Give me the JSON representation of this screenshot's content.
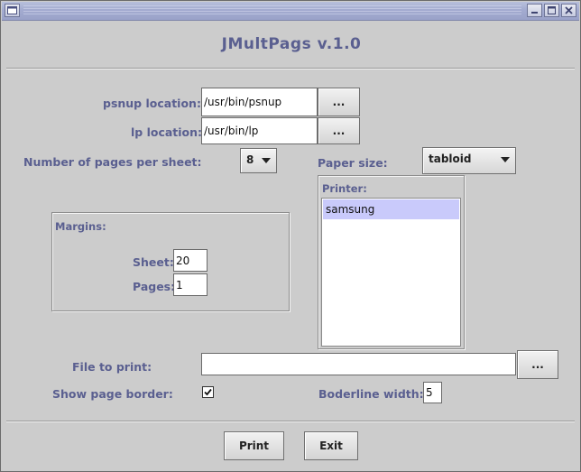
{
  "window": {
    "app_title": "JMultPags v.1.0"
  },
  "form": {
    "psnup_label": "psnup location:",
    "psnup_value": "/usr/bin/psnup",
    "lp_label": "lp location:",
    "lp_value": "/usr/bin/lp",
    "browse_label": "...",
    "pages_per_sheet_label": "Number of pages per sheet:",
    "pages_per_sheet_value": "8",
    "paper_size_label": "Paper size:",
    "paper_size_value": "tabloid",
    "printer_label": "Printer:",
    "printers": [
      "samsung"
    ],
    "margins_label": "Margins:",
    "sheet_label": "Sheet:",
    "sheet_value": "20",
    "pages_label": "Pages:",
    "pages_value": "1",
    "file_label": "File to print:",
    "file_value": "",
    "border_label": "Show page border:",
    "border_checked": true,
    "borderline_label": "Boderline width:",
    "borderline_value": "5"
  },
  "actions": {
    "print_label": "Print",
    "exit_label": "Exit"
  },
  "icons": {
    "window_menu": "window-menu-icon",
    "minimize": "minimize-icon",
    "maximize": "maximize-icon",
    "close": "close-icon",
    "dropdown": "chevron-down-icon",
    "check": "checkmark-icon"
  }
}
